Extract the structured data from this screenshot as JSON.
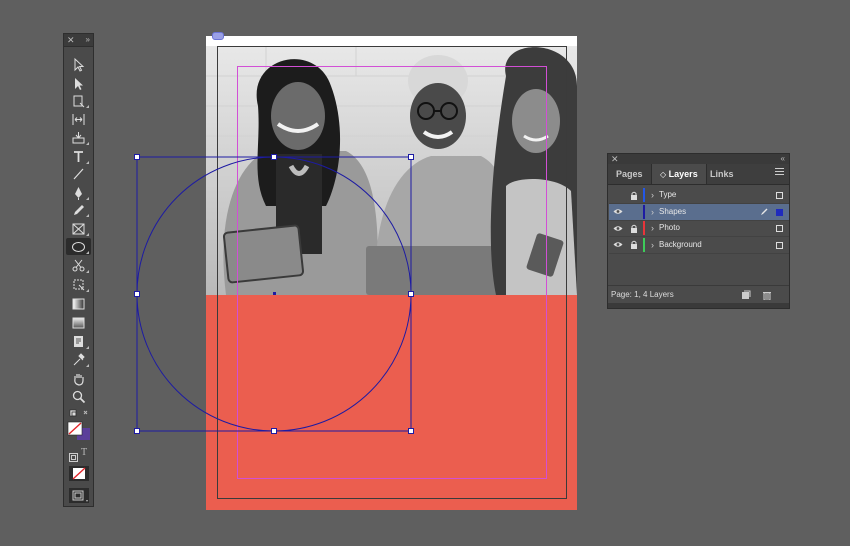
{
  "colors": {
    "background": "#5f5f5f",
    "page_fill": "#eb5e4f",
    "selection": "#1d1ba3",
    "margin_guide": "#d24fd6",
    "layer_type": "#2457e6",
    "layer_shapes": "#1d1ba3",
    "layer_photo": "#e8353a",
    "layer_background": "#3dcc5a"
  },
  "tools_panel": {
    "close_glyph": "✕",
    "collapse_glyph": "»",
    "tools": [
      {
        "name": "selection-tool-icon"
      },
      {
        "name": "direct-selection-tool-icon"
      },
      {
        "name": "page-tool-icon"
      },
      {
        "name": "gap-tool-icon"
      },
      {
        "name": "content-collector-tool-icon"
      },
      {
        "name": "type-tool-icon"
      },
      {
        "name": "line-tool-icon"
      },
      {
        "name": "pen-tool-icon"
      },
      {
        "name": "pencil-tool-icon"
      },
      {
        "name": "rectangle-frame-tool-icon"
      },
      {
        "name": "ellipse-tool-icon",
        "selected": true
      },
      {
        "name": "scissors-tool-icon"
      },
      {
        "name": "free-transform-tool-icon"
      },
      {
        "name": "gradient-swatch-tool-icon"
      },
      {
        "name": "gradient-feather-tool-icon"
      },
      {
        "name": "note-tool-icon"
      },
      {
        "name": "eyedropper-tool-icon"
      },
      {
        "name": "hand-tool-icon"
      },
      {
        "name": "zoom-tool-icon"
      }
    ],
    "type_toggle_label": "T"
  },
  "layers_panel": {
    "close_glyph": "✕",
    "collapse_glyph": "«",
    "tabs": [
      {
        "label": "Pages"
      },
      {
        "label": "Layers",
        "active": true
      },
      {
        "label": "Links"
      }
    ],
    "active_prefix": "◇",
    "layers": [
      {
        "name": "Type",
        "visible": false,
        "locked": true,
        "color": "#2457e6",
        "selected": false
      },
      {
        "name": "Shapes",
        "visible": true,
        "locked": false,
        "color": "#1d1ba3",
        "selected": true
      },
      {
        "name": "Photo",
        "visible": true,
        "locked": true,
        "color": "#e8353a",
        "selected": false
      },
      {
        "name": "Background",
        "visible": true,
        "locked": true,
        "color": "#3dcc5a",
        "selected": false
      }
    ],
    "footer_text": "Page: 1, 4 Layers"
  }
}
